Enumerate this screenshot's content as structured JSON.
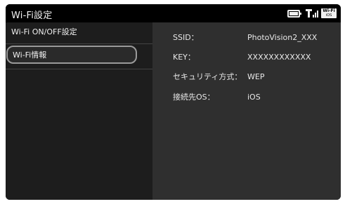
{
  "titlebar": {
    "title": "Wi-Fi設定",
    "wifi_badge": {
      "top": "Wi-Fi",
      "sub": "iOS"
    },
    "icons": [
      "battery-icon",
      "signal-icon",
      "wifi-ios-badge-icon"
    ]
  },
  "sidebar": {
    "items": [
      {
        "label": "Wi-Fi ON/OFF設定",
        "selected": false
      },
      {
        "label": "Wi-Fi情報",
        "selected": true
      }
    ]
  },
  "info": {
    "rows": [
      {
        "label": "SSID：",
        "value": "PhotoVision2_XXX"
      },
      {
        "label": "KEY：",
        "value": "XXXXXXXXXXXX"
      },
      {
        "label": "セキュリティ方式：",
        "value": "WEP"
      },
      {
        "label": "接続先OS：",
        "value": "iOS"
      }
    ]
  },
  "colors": {
    "titlebar_bg": "#000000",
    "sidebar_bg": "#1d1d1d",
    "content_bg": "#2f2f2f",
    "selection_border": "#9a9a9a",
    "text": "#e8e8e8"
  }
}
